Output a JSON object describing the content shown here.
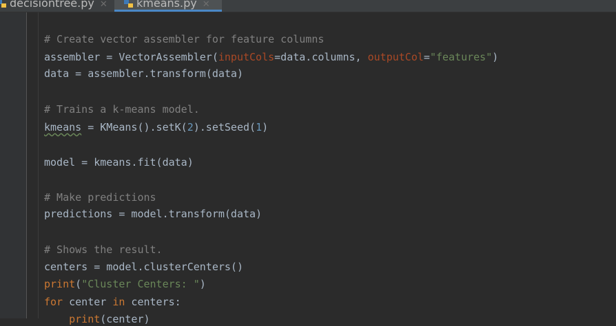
{
  "tabs": [
    {
      "label": "decisiontree.py",
      "icon": "python-icon",
      "active": false
    },
    {
      "label": "kmeans.py",
      "icon": "python-icon",
      "active": true
    }
  ],
  "code": {
    "l1": "# Create vector assembler for feature columns",
    "l2": {
      "a": "assembler = VectorAssembler(",
      "b": "inputCols",
      "c": "=data.columns, ",
      "d": "outputCol",
      "e": "=",
      "f": "\"features\"",
      "g": ")"
    },
    "l3": "data = assembler.transform(data)",
    "l4": "# Trains a k-means model.",
    "l5": {
      "a": "kmeans",
      "b": " = KMeans().setK(",
      "c": "2",
      "d": ").setSeed(",
      "e": "1",
      "f": ")"
    },
    "l6": "model = kmeans.fit(data)",
    "l7": "# Make predictions",
    "l8": "predictions = model.transform(data)",
    "l9": "# Shows the result.",
    "l10": "centers = model.clusterCenters()",
    "l11": {
      "a": "print",
      "b": "(",
      "c": "\"Cluster Centers: \"",
      "d": ")"
    },
    "l12": {
      "a": "for",
      "b": " center ",
      "c": "in",
      "d": " centers:"
    },
    "l13": {
      "a": "    print",
      "b": "(center)"
    }
  },
  "colors": {
    "background": "#2b2b2b",
    "comment": "#808080",
    "keyword": "#cc7832",
    "string": "#6a8759",
    "number": "#6897bb",
    "accent": "#4a88c7"
  }
}
